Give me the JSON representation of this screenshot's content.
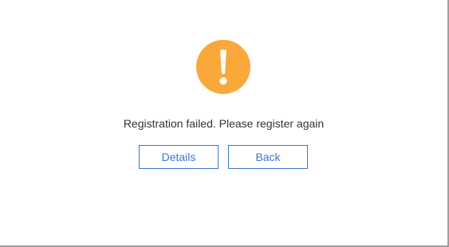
{
  "dialog": {
    "icon": "warning-icon",
    "icon_color": "#FBA83A",
    "message": "Registration failed. Please register again",
    "details_label": "Details",
    "back_label": "Back",
    "button_color": "#3A78C8"
  }
}
